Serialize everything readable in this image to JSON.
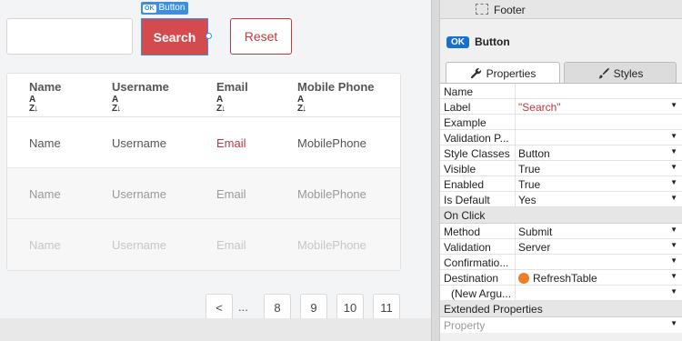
{
  "canvas": {
    "widget_tag": {
      "badge": "OK",
      "label": "Button"
    },
    "search_button": "Search",
    "reset_button": "Reset",
    "table": {
      "headers": [
        "Name",
        "Username",
        "Email",
        "Mobile Phone"
      ],
      "sort_glyph": "A↓Z",
      "rows": [
        [
          "Name",
          "Username",
          "Email",
          "MobilePhone"
        ],
        [
          "Name",
          "Username",
          "Email",
          "MobilePhone"
        ],
        [
          "Name",
          "Username",
          "Email",
          "MobilePhone"
        ]
      ]
    },
    "pagination": {
      "prev": "<",
      "ellipsis": "...",
      "pages": [
        "8",
        "9",
        "10",
        "11"
      ]
    }
  },
  "panel": {
    "tree_item": "Footer",
    "widget_badge": "OK",
    "widget_title": "Button",
    "tabs": [
      "Properties",
      "Styles"
    ],
    "properties": [
      {
        "name": "Name",
        "value": ""
      },
      {
        "name": "Label",
        "value": "\"Search\""
      },
      {
        "name": "Example",
        "value": ""
      },
      {
        "name": "Validation P...",
        "value": ""
      },
      {
        "name": "Style Classes",
        "value": "Button"
      },
      {
        "name": "Visible",
        "value": "True"
      },
      {
        "name": "Enabled",
        "value": "True"
      },
      {
        "name": "Is Default",
        "value": "Yes"
      }
    ],
    "on_click_header": "On Click",
    "on_click": [
      {
        "name": "Method",
        "value": "Submit"
      },
      {
        "name": "Validation",
        "value": "Server"
      },
      {
        "name": "Confirmatio...",
        "value": ""
      },
      {
        "name": "Destination",
        "value": "RefreshTable"
      },
      {
        "name": "(New Argu...",
        "value": ""
      }
    ],
    "extended_header": "Extended Properties",
    "extended_first": "Property",
    "colors": {
      "search_red": "#d44b4f",
      "accent_blue": "#1b6fcc",
      "destination_orange": "#f07d23"
    }
  }
}
